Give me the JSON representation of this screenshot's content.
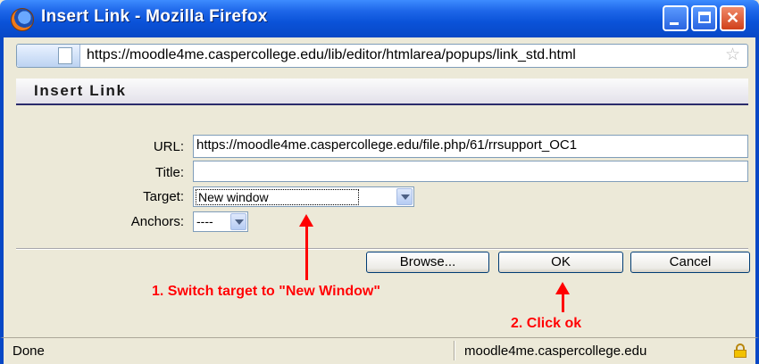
{
  "window": {
    "title": "Insert Link - Mozilla Firefox",
    "address": "https://moodle4me.caspercollege.edu/lib/editor/htmlarea/popups/link_std.html"
  },
  "dialog": {
    "title": "Insert Link",
    "fields": {
      "url_label": "URL:",
      "url_value": "https://moodle4me.caspercollege.edu/file.php/61/rrsupport_OC1",
      "title_label": "Title:",
      "title_value": "",
      "target_label": "Target:",
      "target_value": "New window",
      "anchors_label": "Anchors:",
      "anchors_value": "----"
    },
    "buttons": {
      "browse": "Browse...",
      "ok": "OK",
      "cancel": "Cancel"
    }
  },
  "annotations": {
    "step1": "1. Switch target to \"New Window\"",
    "step2": "2. Click ok"
  },
  "status": {
    "text": "Done",
    "domain": "moodle4me.caspercollege.edu"
  },
  "colors": {
    "titlebar": "#0a52d8",
    "annotation": "#ff0000"
  }
}
